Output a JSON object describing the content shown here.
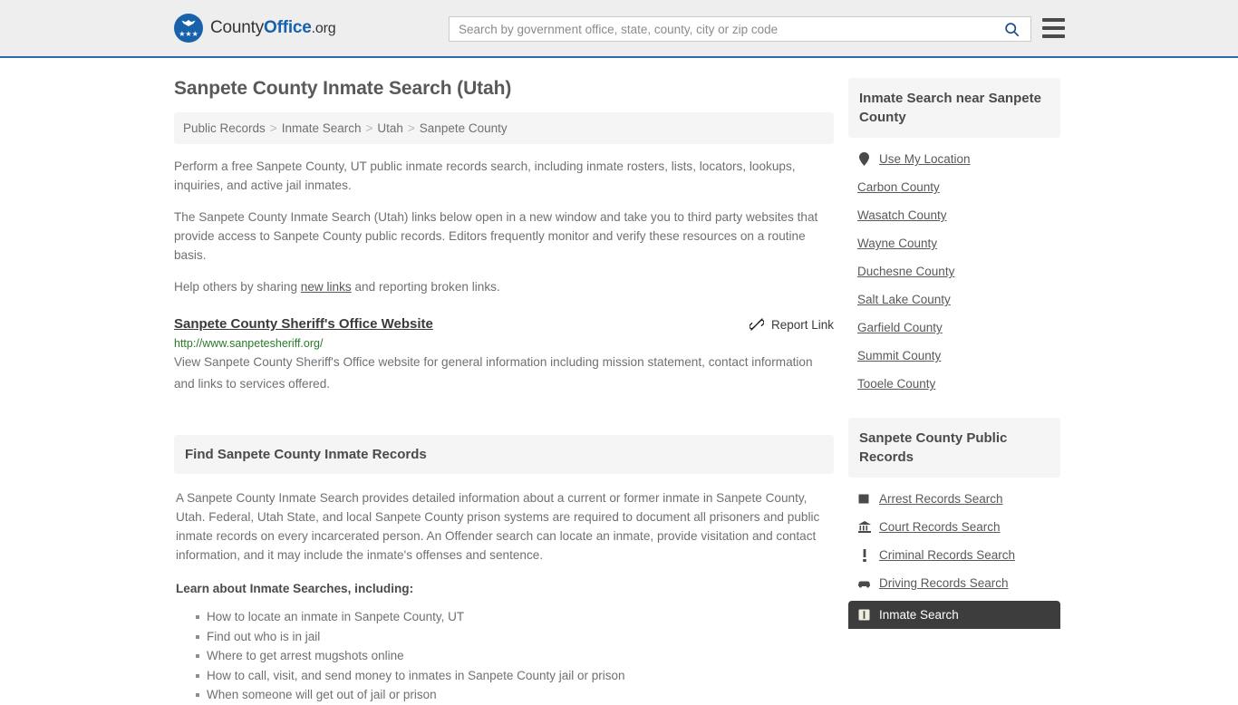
{
  "header": {
    "brand": {
      "part1": "County",
      "part2": "Office",
      "part3": ".org"
    },
    "search": {
      "placeholder": "Search by government office, state, county, city or zip code",
      "value": ""
    },
    "accent_color": "#2b6cab"
  },
  "main": {
    "title": "Sanpete County Inmate Search (Utah)",
    "breadcrumb": [
      "Public Records",
      "Inmate Search",
      "Utah",
      "Sanpete County"
    ],
    "breadcrumb_separator": ">",
    "paragraphs": {
      "p1": "Perform a free Sanpete County, UT public inmate records search, including inmate rosters, lists, locators, lookups, inquiries, and active jail inmates.",
      "p2": "The Sanpete County Inmate Search (Utah) links below open in a new window and take you to third party websites that provide access to Sanpete County public records. Editors frequently monitor and verify these resources on a routine basis.",
      "p3_before": "Help others by sharing ",
      "p3_link": "new links",
      "p3_after": " and reporting broken links."
    },
    "result": {
      "title": "Sanpete County Sheriff's Office Website",
      "report_label": "Report Link",
      "report_icon": "broken-link-icon",
      "url": "http://www.sanpetesheriff.org/",
      "description": "View Sanpete County Sheriff's Office website for general information including mission statement, contact information and links to services offered.",
      "url_color": "#2a7a2a"
    },
    "section": {
      "heading": "Find Sanpete County Inmate Records",
      "paragraph": "A Sanpete County Inmate Search provides detailed information about a current or former inmate in Sanpete County, Utah. Federal, Utah State, and local Sanpete County prison systems are required to document all prisoners and public inmate records on every incarcerated person. An Offender search can locate an inmate, provide visitation and contact information, and it may include the inmate's offenses and sentence.",
      "list_intro": "Learn about Inmate Searches, including:",
      "bullets": [
        "How to locate an inmate in Sanpete County, UT",
        "Find out who is in jail",
        "Where to get arrest mugshots online",
        "How to call, visit, and send money to inmates in Sanpete County jail or prison",
        "When someone will get out of jail or prison"
      ]
    }
  },
  "sidebar": {
    "nearby": {
      "heading": "Inmate Search near Sanpete County",
      "items": [
        {
          "label": "Use My Location",
          "icon": "map-pin-icon",
          "active": false
        },
        {
          "label": "Carbon County",
          "icon": "",
          "active": false
        },
        {
          "label": "Wasatch County",
          "icon": "",
          "active": false
        },
        {
          "label": "Wayne County",
          "icon": "",
          "active": false
        },
        {
          "label": "Duchesne County",
          "icon": "",
          "active": false
        },
        {
          "label": "Salt Lake County",
          "icon": "",
          "active": false
        },
        {
          "label": "Garfield County",
          "icon": "",
          "active": false
        },
        {
          "label": "Summit County",
          "icon": "",
          "active": false
        },
        {
          "label": "Tooele County",
          "icon": "",
          "active": false
        }
      ]
    },
    "public_records": {
      "heading": "Sanpete County Public Records",
      "items": [
        {
          "label": "Arrest Records Search",
          "icon": "square-icon",
          "active": false
        },
        {
          "label": "Court Records Search",
          "icon": "courthouse-icon",
          "active": false
        },
        {
          "label": "Criminal Records Search",
          "icon": "exclamation-icon",
          "active": false
        },
        {
          "label": "Driving Records Search",
          "icon": "car-icon",
          "active": false
        },
        {
          "label": "Inmate Search",
          "icon": "inmate-icon",
          "active": true
        }
      ],
      "active_bg": "#3d3d3d"
    }
  }
}
